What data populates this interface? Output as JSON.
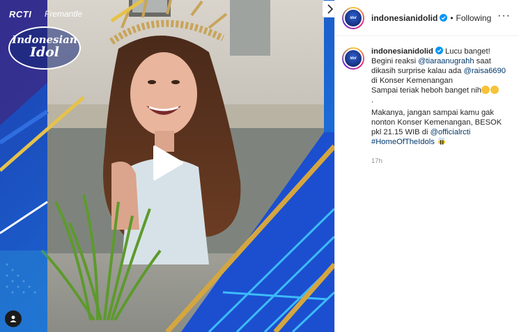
{
  "media": {
    "brand_rcti": "RCTI",
    "brand_fremantle": "Fremantle",
    "logo_line1": "Indonesian",
    "logo_line2": "Idol",
    "play_icon": "play-icon",
    "user_tag_icon": "user-icon",
    "next_icon": "chevron-right-icon"
  },
  "header": {
    "username": "indonesianidolid",
    "verified_icon": "verified-badge-icon",
    "separator": "•",
    "follow_status": "Following",
    "more_icon": "more-options-icon",
    "more_glyph": "···"
  },
  "caption": {
    "username": "indonesianidolid",
    "line1": "Lucu banget!",
    "line2_prefix": "Begini reaksi ",
    "mention1": "@tiaraanugrahh",
    "line2_suffix": " saat dikasih surprise kalau ada ",
    "mention2": "@raisa6690",
    "line3": " di Konser Kemenangan",
    "line4": "Sampai teriak heboh banget nih",
    "period": ".",
    "line5": "Makanya, jangan sampai kamu gak nonton Konser Kemenangan, BESOK pkl 21.15 WIB di ",
    "mention3": "@officialrcti",
    "hashtag": "#HomeOfTheIdols",
    "timestamp": "17h"
  },
  "colors": {
    "link": "#00376b",
    "verified": "#0095f6",
    "muted": "#8e8e8e"
  }
}
